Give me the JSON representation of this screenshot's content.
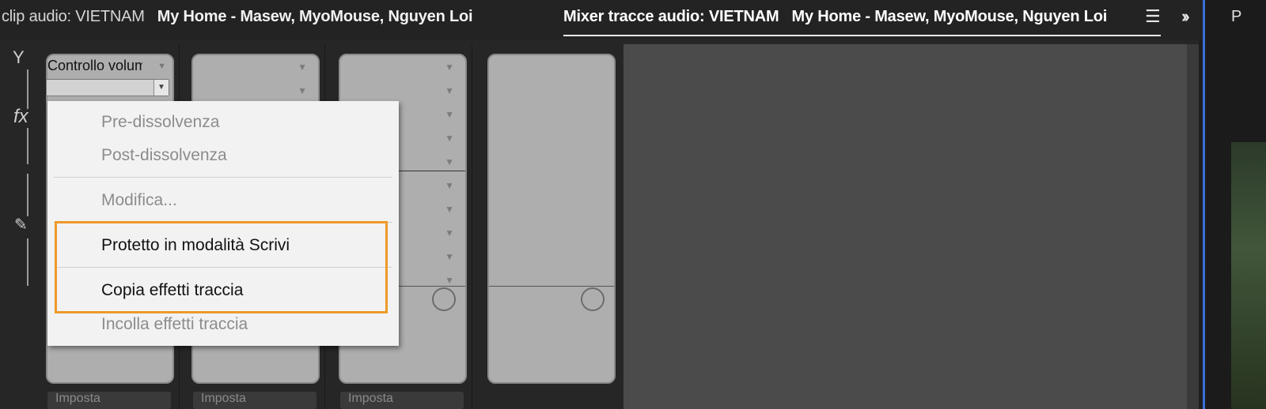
{
  "header": {
    "left_tab_label": "clip audio: VIETNAM",
    "left_tab_track": "My Home - Masew, MyoMouse, Nguyen Loi",
    "active_tab_label": "Mixer tracce audio: VIETNAM",
    "active_tab_track": "My Home - Masew, MyoMouse, Nguyen Loi",
    "menu_icon": "hamburger-icon",
    "overflow_icon": "double-chevron-right-icon"
  },
  "right_panel": {
    "label": "P"
  },
  "rail": {
    "fx_glyph": "fx",
    "pen_glyph": "✎"
  },
  "effect_slot": {
    "label": "Controllo volume"
  },
  "strip_footer_label": "Imposta",
  "context_menu": {
    "items": [
      {
        "label": "Pre-dissolvenza",
        "enabled": false
      },
      {
        "label": "Post-dissolvenza",
        "enabled": false
      },
      {
        "label": "Modifica...",
        "enabled": false
      },
      {
        "label": "Protetto in modalità Scrivi",
        "enabled": true
      },
      {
        "label": "Copia effetti traccia",
        "enabled": true
      },
      {
        "label": "Incolla effetti traccia",
        "enabled": false
      }
    ]
  },
  "colors": {
    "highlight": "#ee9a2a",
    "accent_blue": "#3a6fd6"
  }
}
